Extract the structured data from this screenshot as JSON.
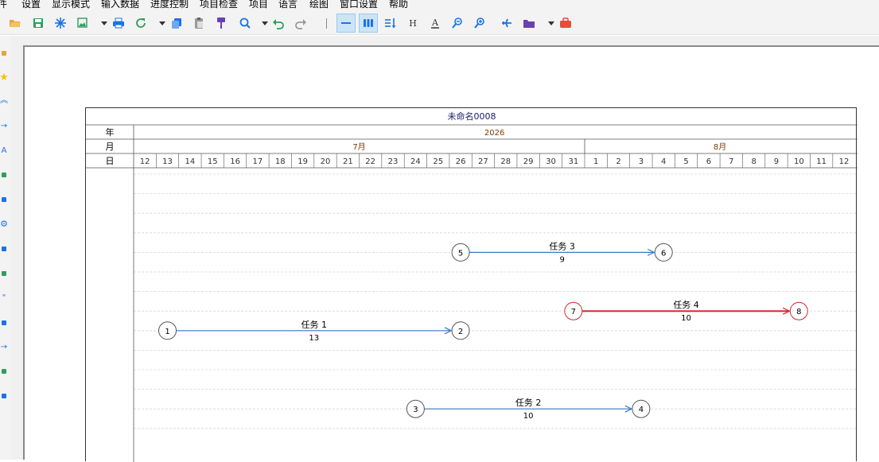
{
  "menubar": {
    "items": [
      "件",
      "设置",
      "显示模式",
      "输入数据",
      "进度控制",
      "项目检查",
      "项目",
      "语言",
      "绘图",
      "窗口设置",
      "帮助"
    ]
  },
  "toolbar": {
    "buttons": [
      {
        "name": "open-folder-icon",
        "color": "#e8a33d"
      },
      {
        "name": "save-icon",
        "color": "#2e9e5b"
      },
      {
        "name": "snowflake-icon",
        "color": "#1a73e8"
      },
      {
        "name": "image-export-icon",
        "color": "#2e9e5b"
      },
      {
        "name": "print-icon",
        "color": "#1a73e8"
      },
      {
        "name": "refresh-icon",
        "color": "#2e9e5b"
      },
      {
        "name": "copy-icon",
        "color": "#1a73e8"
      },
      {
        "name": "paste-icon",
        "color": "#999999"
      },
      {
        "name": "format-brush-icon",
        "color": "#6a3fb5"
      },
      {
        "name": "search-icon",
        "color": "#1a73e8"
      },
      {
        "name": "undo-icon",
        "color": "#2e9e5b"
      },
      {
        "name": "redo-icon",
        "color": "#999999"
      },
      {
        "name": "single-line-view-icon",
        "color": "#1a73e8"
      },
      {
        "name": "multi-bar-view-icon",
        "color": "#1a73e8"
      },
      {
        "name": "sort-icon",
        "color": "#1a73e8"
      },
      {
        "name": "height-icon",
        "color": "#333333"
      },
      {
        "name": "font-color-icon",
        "color": "#333333"
      },
      {
        "name": "zoom-out-icon",
        "color": "#1a73e8"
      },
      {
        "name": "zoom-in-icon",
        "color": "#1a73e8"
      },
      {
        "name": "airplane-icon",
        "color": "#1a73e8"
      },
      {
        "name": "folder-icon",
        "color": "#6a3fb5"
      },
      {
        "name": "toolbox-icon",
        "color": "#e74c3c"
      }
    ],
    "height_label": "H",
    "font_label": "A"
  },
  "leftbar": {
    "icons": [
      "flag-icon",
      "star-icon",
      "double-chevron-icon",
      "arrow-right-icon",
      "letter-a-icon",
      "pen-icon",
      "dots-icon",
      "gear-icon",
      "sort-arrows-icon",
      "people-icon",
      "quote-icon",
      "list-icon",
      "arrow-right-icon",
      "chart-icon",
      "pencil-icon"
    ],
    "a_label": "A",
    "quote_label": "\""
  },
  "chart": {
    "title": "未命名0008",
    "row_labels": {
      "year": "年",
      "month": "月",
      "day": "日"
    },
    "year": "2026",
    "months": [
      {
        "label": "7月",
        "start_index": 0,
        "days": 20
      },
      {
        "label": "8月",
        "start_index": 20,
        "days": 12
      }
    ]
  },
  "chart_data": {
    "type": "network-schedule",
    "title": "未命名0008",
    "year": "2026",
    "dates": [
      "7-12",
      "7-13",
      "7-14",
      "7-15",
      "7-16",
      "7-17",
      "7-18",
      "7-19",
      "7-20",
      "7-21",
      "7-22",
      "7-23",
      "7-24",
      "7-25",
      "7-26",
      "7-27",
      "7-28",
      "7-29",
      "7-30",
      "7-31",
      "8-1",
      "8-2",
      "8-3",
      "8-4",
      "8-5",
      "8-6",
      "8-7",
      "8-8",
      "8-9",
      "8-10",
      "8-11",
      "8-12"
    ],
    "day_labels": [
      "12",
      "13",
      "14",
      "15",
      "16",
      "17",
      "18",
      "19",
      "20",
      "21",
      "22",
      "23",
      "24",
      "25",
      "26",
      "27",
      "28",
      "29",
      "30",
      "31",
      "1",
      "2",
      "3",
      "4",
      "5",
      "6",
      "7",
      "8",
      "9",
      "10",
      "11",
      "12"
    ],
    "tasks": [
      {
        "name": "任务 1",
        "duration": "13",
        "from_node": "1",
        "to_node": "2",
        "start": "7-13",
        "end": "7-26",
        "row": 8,
        "critical": false
      },
      {
        "name": "任务 3",
        "duration": "9",
        "from_node": "5",
        "to_node": "6",
        "start": "7-26",
        "end": "8-4",
        "row": 4,
        "critical": false
      },
      {
        "name": "任务 4",
        "duration": "10",
        "from_node": "7",
        "to_node": "8",
        "start": "7-31",
        "end": "8-10",
        "row": 7,
        "critical": true
      },
      {
        "name": "任务 2",
        "duration": "10",
        "from_node": "3",
        "to_node": "4",
        "start": "7-24",
        "end": "8-3",
        "row": 12,
        "critical": false
      }
    ],
    "colors": {
      "normal": "#3b78c2",
      "critical": "#d42a2a",
      "grid": "#d8d8d8",
      "header_text": "#7a3b00"
    }
  }
}
